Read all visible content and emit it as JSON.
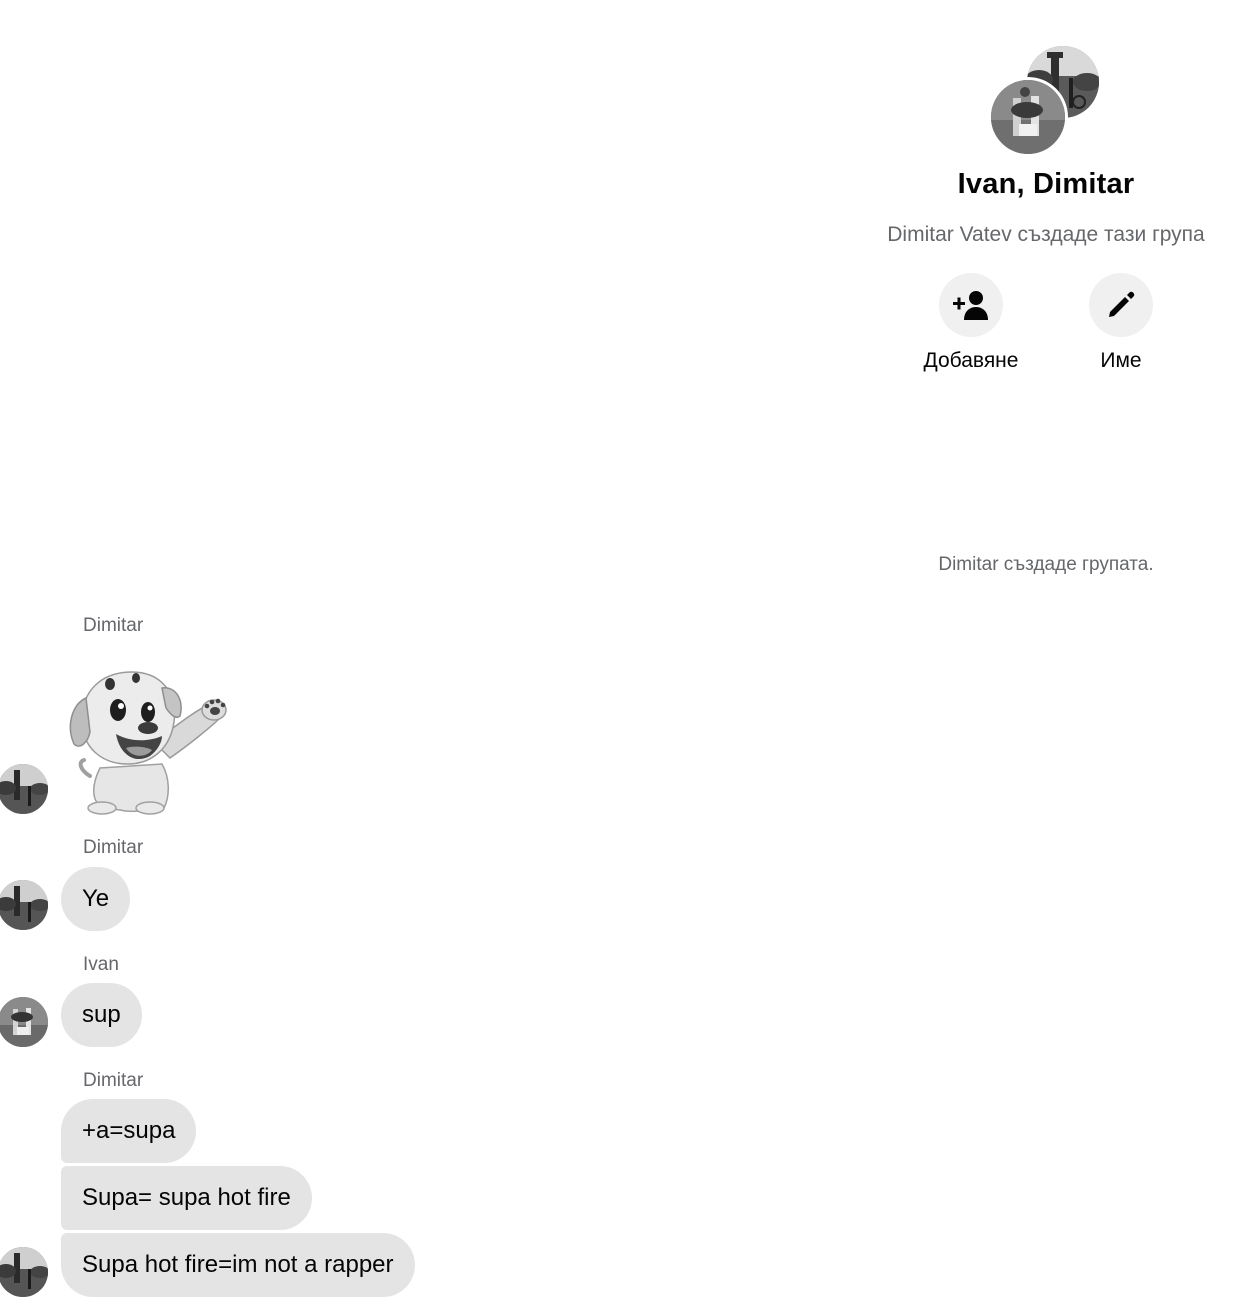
{
  "group": {
    "title": "Ivan, Dimitar",
    "subtitle": "Dimitar Vatev създаде тази група",
    "actions": [
      {
        "label": "Добавяне",
        "icon": "add-person-icon"
      },
      {
        "label": "Име",
        "icon": "pencil-icon"
      }
    ]
  },
  "system_message": "Dimitar създаде групата.",
  "messages": [
    {
      "sender": "Dimitar",
      "sticker": "waving-dog-sticker"
    },
    {
      "sender": "Dimitar",
      "bubbles": [
        "Ye"
      ]
    },
    {
      "sender": "Ivan",
      "bubbles": [
        "sup"
      ]
    },
    {
      "sender": "Dimitar",
      "bubbles": [
        "+a=supa",
        "Supa= supa hot fire",
        "Supa hot fire=im not a rapper"
      ]
    }
  ],
  "colors": {
    "bubble_background": "#e4e4e4",
    "secondary_text": "#65676b",
    "action_circle_background": "#f0f0f0"
  }
}
